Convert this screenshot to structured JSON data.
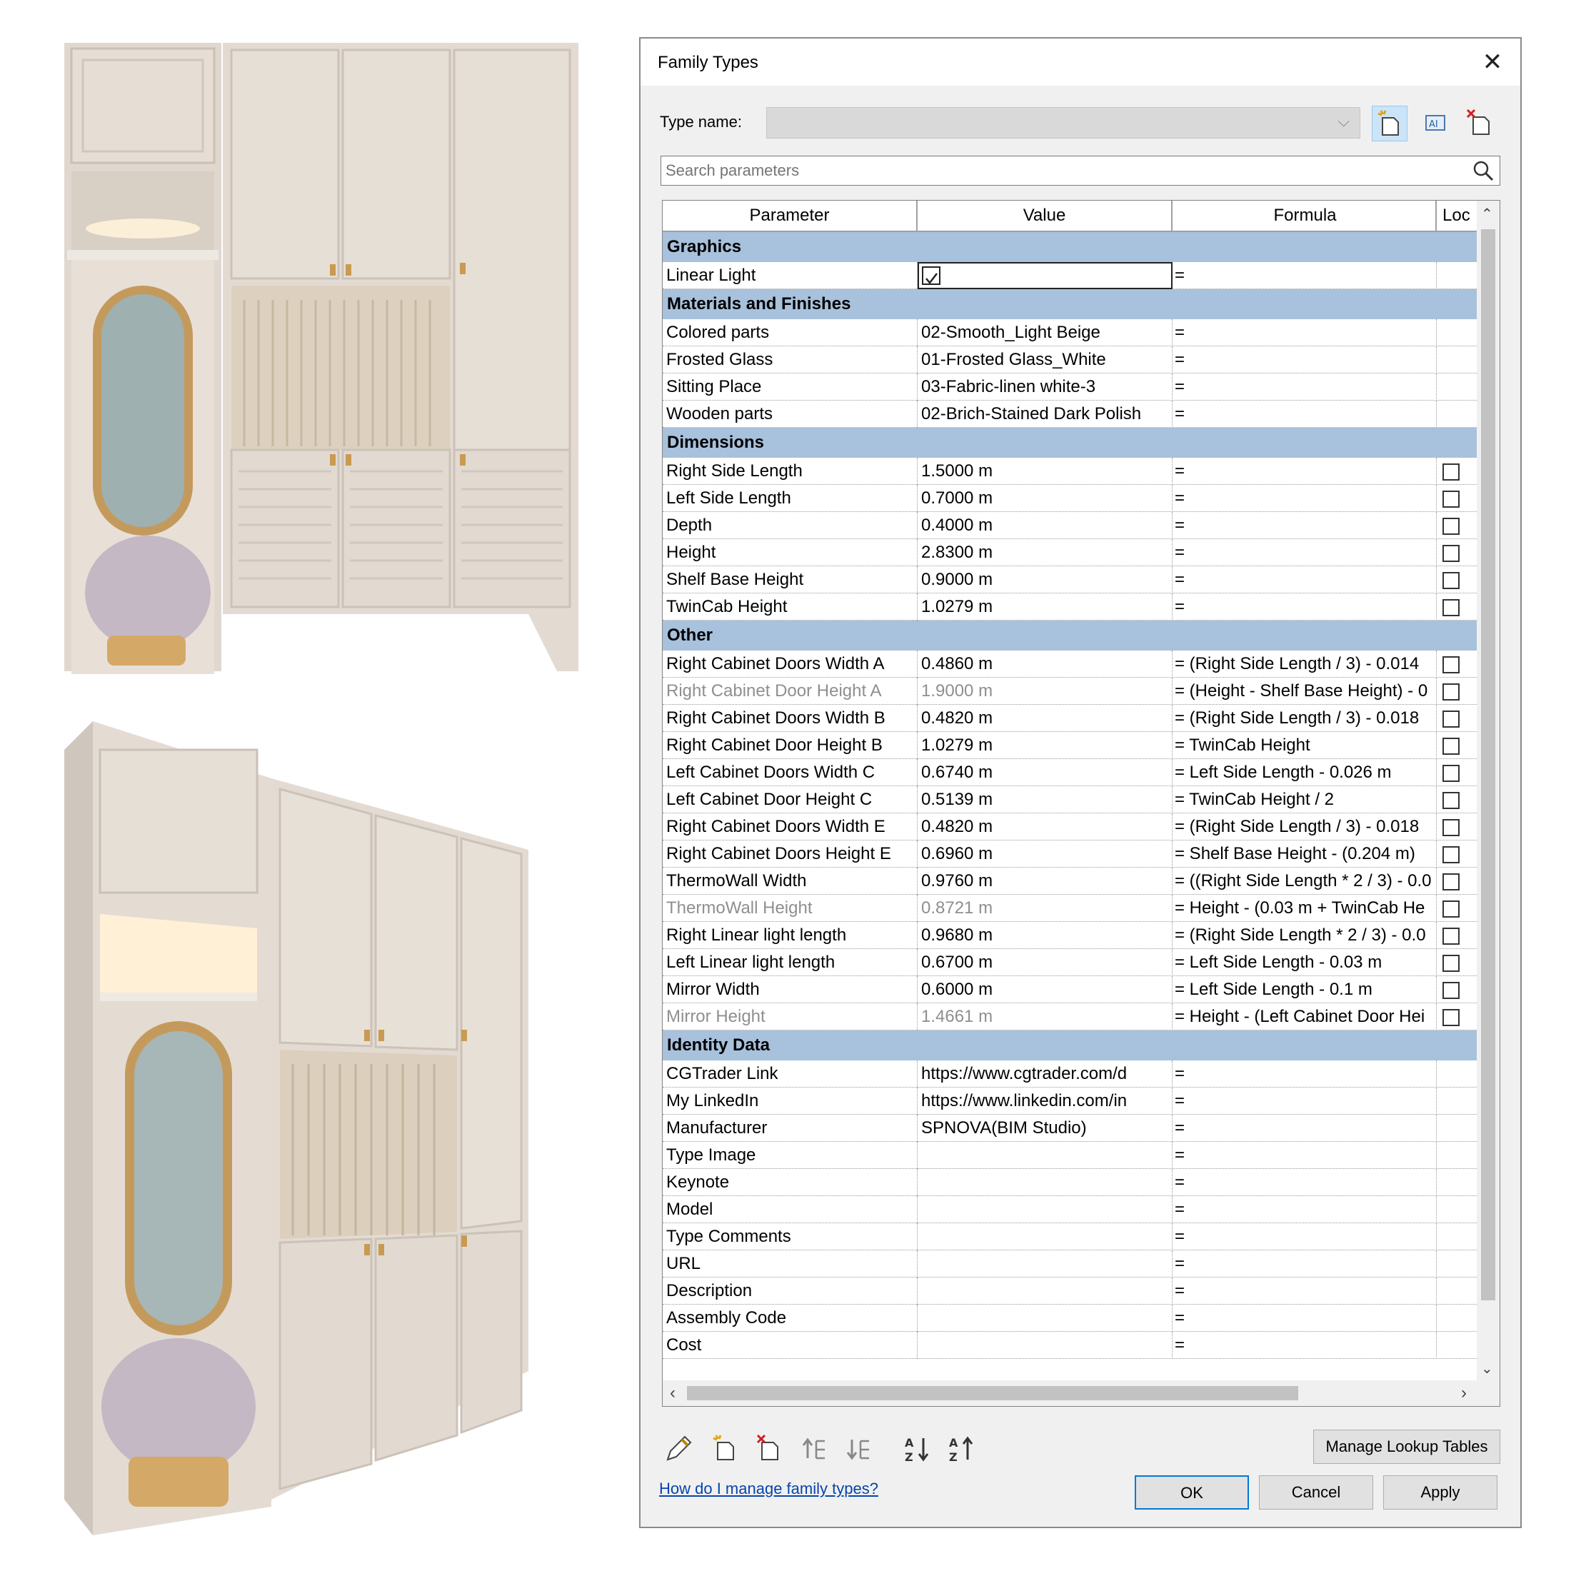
{
  "dialog": {
    "title": "Family Types",
    "type_name_label": "Type name:",
    "type_name_value": "",
    "search_placeholder": "Search parameters",
    "columns": [
      "Parameter",
      "Value",
      "Formula",
      "Loc"
    ],
    "groups": [
      {
        "name": "Graphics",
        "rows": [
          {
            "param": "Linear Light",
            "value": "",
            "checkbox": true,
            "formula": "=",
            "lock": false
          }
        ]
      },
      {
        "name": "Materials and Finishes",
        "rows": [
          {
            "param": "Colored parts",
            "value": "02-Smooth_Light Beige",
            "formula": "=",
            "lock": false
          },
          {
            "param": "Frosted Glass",
            "value": "01-Frosted Glass_White",
            "formula": "=",
            "lock": false
          },
          {
            "param": "Sitting Place",
            "value": "03-Fabric-linen white-3",
            "formula": "=",
            "lock": false
          },
          {
            "param": "Wooden parts",
            "value": "02-Brich-Stained Dark Polish",
            "formula": "=",
            "lock": false
          }
        ]
      },
      {
        "name": "Dimensions",
        "rows": [
          {
            "param": "Right Side Length",
            "value": "1.5000 m",
            "formula": "=",
            "lock": true
          },
          {
            "param": "Left Side Length",
            "value": "0.7000 m",
            "formula": "=",
            "lock": true
          },
          {
            "param": "Depth",
            "value": "0.4000 m",
            "formula": "=",
            "lock": true
          },
          {
            "param": "Height",
            "value": "2.8300 m",
            "formula": "=",
            "lock": true
          },
          {
            "param": "Shelf Base Height",
            "value": "0.9000 m",
            "formula": "=",
            "lock": true
          },
          {
            "param": "TwinCab Height",
            "value": "1.0279 m",
            "formula": "=",
            "lock": true
          }
        ]
      },
      {
        "name": "Other",
        "rows": [
          {
            "param": "Right Cabinet Doors Width A",
            "value": "0.4860 m",
            "formula": "= (Right Side Length / 3) - 0.014",
            "lock": true
          },
          {
            "param": "Right Cabinet Door Height A",
            "value": "1.9000 m",
            "formula": "= (Height - Shelf Base Height) - 0",
            "lock": true,
            "dim": true
          },
          {
            "param": "Right Cabinet Doors Width B",
            "value": "0.4820 m",
            "formula": "= (Right Side Length / 3) - 0.018",
            "lock": true
          },
          {
            "param": "Right Cabinet Door Height B",
            "value": "1.0279 m",
            "formula": "= TwinCab Height",
            "lock": true
          },
          {
            "param": "Left Cabinet Doors Width C",
            "value": "0.6740 m",
            "formula": "= Left Side Length - 0.026 m",
            "lock": true
          },
          {
            "param": "Left Cabinet Door Height C",
            "value": "0.5139 m",
            "formula": "= TwinCab Height / 2",
            "lock": true
          },
          {
            "param": "Right Cabinet Doors Width E",
            "value": "0.4820 m",
            "formula": "= (Right Side Length / 3) - 0.018",
            "lock": true
          },
          {
            "param": "Right Cabinet Doors Height E",
            "value": "0.6960 m",
            "formula": "= Shelf Base Height - (0.204 m)",
            "lock": true
          },
          {
            "param": "ThermoWall Width",
            "value": "0.9760 m",
            "formula": "= ((Right Side Length * 2 / 3) - 0.0",
            "lock": true
          },
          {
            "param": "ThermoWall Height",
            "value": "0.8721 m",
            "formula": "= Height - (0.03 m + TwinCab He",
            "lock": true,
            "dim": true
          },
          {
            "param": "Right Linear light length",
            "value": "0.9680 m",
            "formula": "= (Right Side Length * 2 / 3) - 0.0",
            "lock": true
          },
          {
            "param": "Left Linear light length",
            "value": "0.6700 m",
            "formula": "= Left Side Length - 0.03 m",
            "lock": true
          },
          {
            "param": "Mirror Width",
            "value": "0.6000 m",
            "formula": "= Left Side Length - 0.1 m",
            "lock": true
          },
          {
            "param": "Mirror Height",
            "value": "1.4661 m",
            "formula": "= Height - (Left Cabinet Door Hei",
            "lock": true,
            "dim": true
          }
        ]
      },
      {
        "name": "Identity Data",
        "rows": [
          {
            "param": "CGTrader Link",
            "value": "https://www.cgtrader.com/d",
            "formula": "=",
            "lock": false
          },
          {
            "param": "My LinkedIn",
            "value": "https://www.linkedin.com/in",
            "formula": "=",
            "lock": false
          },
          {
            "param": "Manufacturer",
            "value": "SPNOVA(BIM Studio)",
            "formula": "=",
            "lock": false
          },
          {
            "param": "Type Image",
            "value": "",
            "formula": "=",
            "lock": false
          },
          {
            "param": "Keynote",
            "value": "",
            "formula": "=",
            "lock": false
          },
          {
            "param": "Model",
            "value": "",
            "formula": "=",
            "lock": false
          },
          {
            "param": "Type Comments",
            "value": "",
            "formula": "=",
            "lock": false
          },
          {
            "param": "URL",
            "value": "",
            "formula": "=",
            "lock": false
          },
          {
            "param": "Description",
            "value": "",
            "formula": "=",
            "lock": false
          },
          {
            "param": "Assembly Code",
            "value": "",
            "formula": "=",
            "lock": false
          },
          {
            "param": "Cost",
            "value": "",
            "formula": "=",
            "lock": false
          }
        ]
      }
    ],
    "toolbar_icons": [
      "pencil-icon",
      "new-parameter-icon",
      "delete-parameter-icon",
      "move-up-icon",
      "move-down-icon",
      "sort-ascending-icon",
      "sort-descending-icon"
    ],
    "manage_lookup_label": "Manage Lookup Tables",
    "help_link": "How do I manage family types?",
    "ok_label": "OK",
    "cancel_label": "Cancel",
    "apply_label": "Apply"
  },
  "colors": {
    "group_header": "#a8c1dc",
    "link": "#0645ad",
    "cabinet": "#e3dbd2",
    "stool": "#c6bcc6"
  }
}
